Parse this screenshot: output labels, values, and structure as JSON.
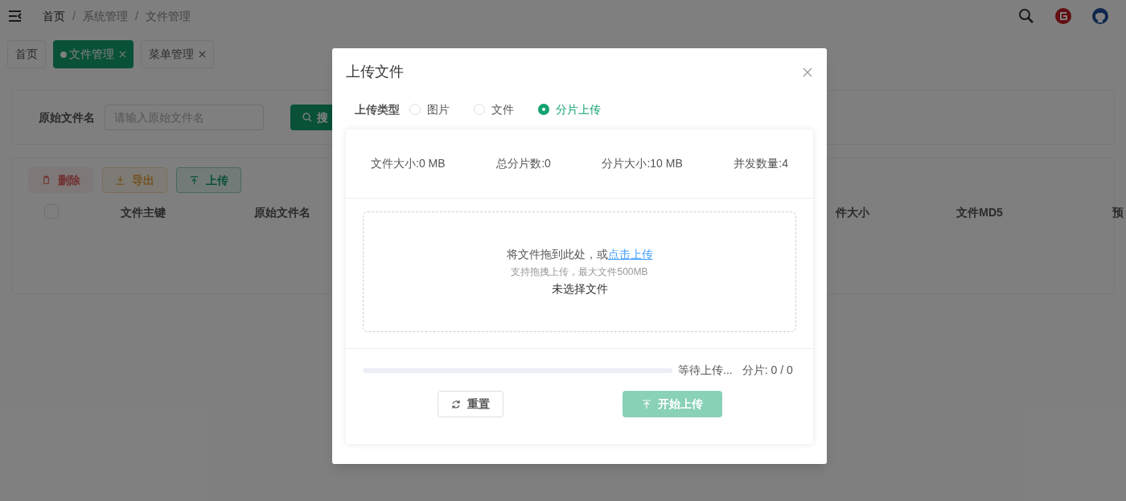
{
  "breadcrumb": [
    {
      "kind": "link",
      "text": "首页"
    },
    {
      "kind": "separator",
      "text": "/"
    },
    {
      "kind": "link",
      "text": "系统管理"
    },
    {
      "kind": "separator",
      "text": "/"
    },
    {
      "kind": "current",
      "text": "文件管理"
    }
  ],
  "tags": [
    {
      "label": "首页",
      "selected": false,
      "closable": false
    },
    {
      "label": "文件管理",
      "selected": true,
      "closable": true
    },
    {
      "label": "菜单管理",
      "selected": false,
      "closable": true
    }
  ],
  "search_form": {
    "label": "原始文件名",
    "placeholder": "请输入原始文件名",
    "button": "搜"
  },
  "toolbar": [
    {
      "label": "删除",
      "kind": "danger",
      "disabled": true
    },
    {
      "label": "导出",
      "kind": "warning",
      "disabled": false
    },
    {
      "label": "上传",
      "kind": "primary",
      "disabled": false
    }
  ],
  "table": {
    "select_all": {
      "checked": false
    },
    "columns": [
      {
        "label": "文件主键"
      },
      {
        "label": "原始文件名"
      },
      {
        "label": "件大小"
      },
      {
        "label": "文件MD5"
      },
      {
        "label": "预"
      }
    ]
  },
  "dialog": {
    "title": "上传文件",
    "type_label": "上传类型",
    "types": [
      {
        "label": "图片",
        "selected": false
      },
      {
        "label": "文件",
        "selected": false
      },
      {
        "label": "分片上传",
        "selected": true
      }
    ],
    "stats": [
      "文件大小:0 MB",
      "总分片数:0",
      "分片大小:10 MB",
      "并发数量:4"
    ],
    "dropzone": {
      "text": "将文件拖到此处，或",
      "link": "点击上传",
      "hint": "支持拖拽上传，最大文件500MB",
      "status": "未选择文件"
    },
    "progress": {
      "level": 0,
      "status": "等待上传...",
      "chunks": "分片: 0 / 0"
    },
    "buttons": [
      {
        "label": "重置",
        "kind": "reset",
        "disabled": false
      },
      {
        "label": "开始上传",
        "kind": "upload",
        "disabled": true
      }
    ]
  }
}
